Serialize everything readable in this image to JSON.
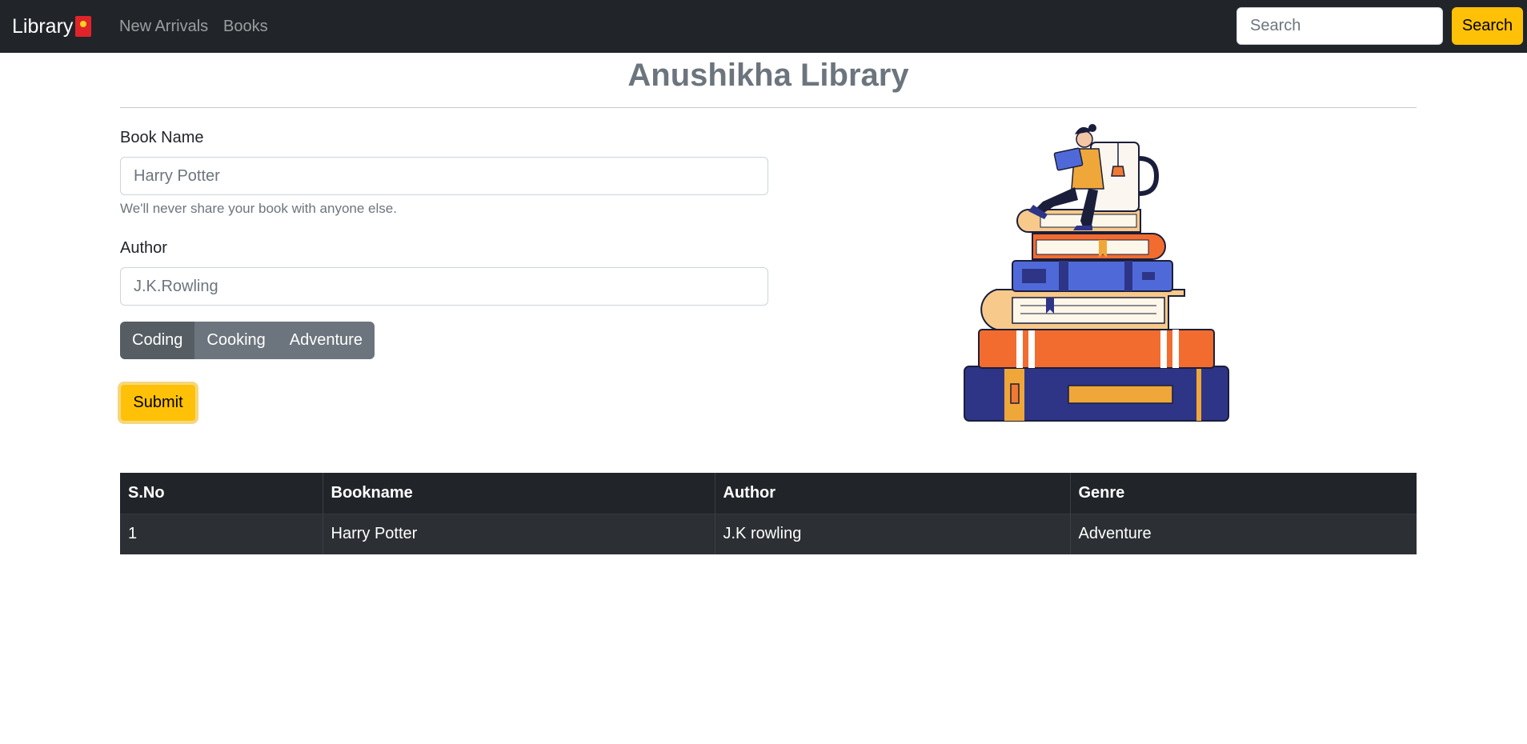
{
  "navbar": {
    "brand": "Library",
    "links": [
      "New Arrivals",
      "Books"
    ],
    "search_placeholder": "Search",
    "search_button": "Search"
  },
  "page": {
    "title": "Anushikha Library"
  },
  "form": {
    "book_label": "Book Name",
    "book_placeholder": "Harry Potter",
    "book_help": "We'll never share your book with anyone else.",
    "author_label": "Author",
    "author_placeholder": "J.K.Rowling",
    "genres": [
      "Coding",
      "Cooking",
      "Adventure"
    ],
    "selected_genre": "Coding",
    "submit_label": "Submit"
  },
  "table": {
    "headers": [
      "S.No",
      "Bookname",
      "Author",
      "Genre"
    ],
    "rows": [
      [
        "1",
        "Harry Potter",
        "J.K rowling",
        "Adventure"
      ]
    ]
  },
  "colors": {
    "navbar": "#212529",
    "accent": "#ffc107",
    "title": "#6c757d"
  }
}
